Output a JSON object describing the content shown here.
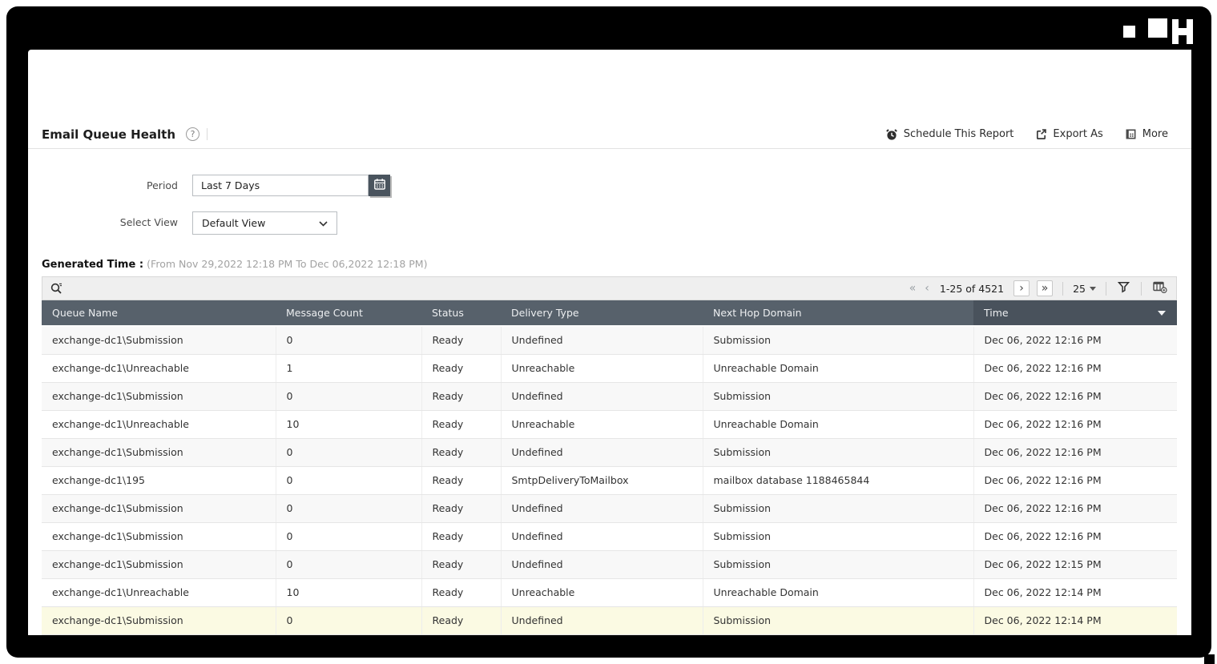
{
  "window": {
    "deco_icons": [
      "logo-block-small-square",
      "logo-block-large-square",
      "logo-block-h-glyph",
      "corner-block"
    ]
  },
  "header": {
    "title": "Email Queue Health",
    "help_icon": "?",
    "actions": [
      {
        "label": "Schedule This Report",
        "icon": "alarm-clock-icon"
      },
      {
        "label": "Export As",
        "icon": "export-icon"
      },
      {
        "label": "More",
        "icon": "more-icon"
      }
    ]
  },
  "filters": {
    "period_label": "Period",
    "period_value": "Last 7 Days",
    "calendar_icon": "calendar-icon",
    "select_view_label": "Select View",
    "select_view_value": "Default View",
    "chevron_icon": "chevron-down-icon"
  },
  "generated_time": {
    "label": "Generated Time :",
    "range": "(From Nov 29,2022 12:18 PM To Dec 06,2022 12:18 PM)"
  },
  "toolbar": {
    "search_icon": "search-icon",
    "pagination": {
      "first": "«",
      "prev": "‹",
      "range": "1-25 of 4521",
      "next": "›",
      "last": "»"
    },
    "page_size": "25",
    "filter_icon": "funnel-icon",
    "column_chooser_icon": "column-chooser-icon"
  },
  "table": {
    "columns": [
      "Queue Name",
      "Message Count",
      "Status",
      "Delivery Type",
      "Next Hop Domain",
      "Time"
    ],
    "sorted_column": "Time",
    "sort_direction": "desc",
    "highlighted_row_index": 10,
    "rows": [
      [
        "exchange-dc1\\Submission",
        "0",
        "Ready",
        "Undefined",
        "Submission",
        "Dec 06, 2022 12:16 PM"
      ],
      [
        "exchange-dc1\\Unreachable",
        "1",
        "Ready",
        "Unreachable",
        "Unreachable Domain",
        "Dec 06, 2022 12:16 PM"
      ],
      [
        "exchange-dc1\\Submission",
        "0",
        "Ready",
        "Undefined",
        "Submission",
        "Dec 06, 2022 12:16 PM"
      ],
      [
        "exchange-dc1\\Unreachable",
        "10",
        "Ready",
        "Unreachable",
        "Unreachable Domain",
        "Dec 06, 2022 12:16 PM"
      ],
      [
        "exchange-dc1\\Submission",
        "0",
        "Ready",
        "Undefined",
        "Submission",
        "Dec 06, 2022 12:16 PM"
      ],
      [
        "exchange-dc1\\195",
        "0",
        "Ready",
        "SmtpDeliveryToMailbox",
        "mailbox database 1188465844",
        "Dec 06, 2022 12:16 PM"
      ],
      [
        "exchange-dc1\\Submission",
        "0",
        "Ready",
        "Undefined",
        "Submission",
        "Dec 06, 2022 12:16 PM"
      ],
      [
        "exchange-dc1\\Submission",
        "0",
        "Ready",
        "Undefined",
        "Submission",
        "Dec 06, 2022 12:16 PM"
      ],
      [
        "exchange-dc1\\Submission",
        "0",
        "Ready",
        "Undefined",
        "Submission",
        "Dec 06, 2022 12:15 PM"
      ],
      [
        "exchange-dc1\\Unreachable",
        "10",
        "Ready",
        "Unreachable",
        "Unreachable Domain",
        "Dec 06, 2022 12:14 PM"
      ],
      [
        "exchange-dc1\\Submission",
        "0",
        "Ready",
        "Undefined",
        "Submission",
        "Dec 06, 2022 12:14 PM"
      ]
    ]
  },
  "colors": {
    "frame": "#000000",
    "table_header_bg": "#57616b",
    "table_header_sorted_bg": "#49525c",
    "row_alt_bg": "#f8f8f8",
    "row_highlight_bg": "#fbfae3",
    "calendar_button_bg": "#4a545e",
    "toolbar_bg": "#efefef"
  }
}
